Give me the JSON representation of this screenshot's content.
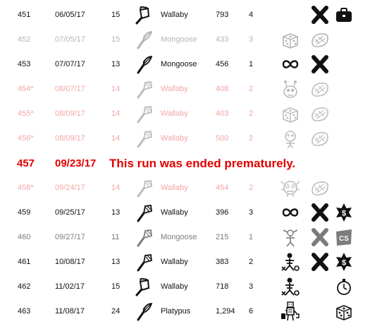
{
  "runs": [
    {
      "num": "451",
      "date": "06/05/17",
      "level": "15",
      "name": "Wallaby",
      "score": "793",
      "count": "4",
      "state": "normal",
      "icons": {
        "char": "pan-icon",
        "a": "",
        "b": "x-mark-icon",
        "c": "briefcase-icon"
      }
    },
    {
      "num": "452",
      "date": "07/05/17",
      "level": "15",
      "name": "Mongoose",
      "score": "433",
      "count": "3",
      "state": "ghost",
      "icons": {
        "char": "whisk-icon",
        "a": "dice-icon",
        "b": "steak-icon",
        "c": ""
      }
    },
    {
      "num": "453",
      "date": "07/07/17",
      "level": "13",
      "name": "Mongoose",
      "score": "456",
      "count": "1",
      "state": "normal",
      "icons": {
        "char": "whisk-icon",
        "a": "infinity-icon",
        "b": "x-mark-icon",
        "c": ""
      }
    },
    {
      "num": "454*",
      "date": "08/07/17",
      "level": "14",
      "name": "Wallaby",
      "score": "408",
      "count": "2",
      "state": "pink",
      "icons": {
        "char": "spatula-icon",
        "a": "alien-icon",
        "b": "steak-icon",
        "c": ""
      }
    },
    {
      "num": "455*",
      "date": "08/09/17",
      "level": "14",
      "name": "Wallaby",
      "score": "403",
      "count": "2",
      "state": "pink",
      "icons": {
        "char": "spatula-icon",
        "a": "dice-icon",
        "b": "steak-icon",
        "c": ""
      }
    },
    {
      "num": "456*",
      "date": "08/09/17",
      "level": "14",
      "name": "Wallaby",
      "score": "500",
      "count": "2",
      "state": "pink",
      "icons": {
        "char": "spatula-icon",
        "a": "skull-icon",
        "b": "steak-icon",
        "c": ""
      }
    },
    {
      "state": "ended",
      "num": "457",
      "date": "09/23/17",
      "message": "This run was ended prematurely."
    },
    {
      "num": "458*",
      "date": "09/24/17",
      "level": "14",
      "name": "Wallaby",
      "score": "454",
      "count": "2",
      "state": "pink",
      "icons": {
        "char": "spatula-icon",
        "a": "gremlin-icon",
        "b": "steak-icon",
        "c": ""
      }
    },
    {
      "num": "459",
      "date": "09/25/17",
      "level": "13",
      "name": "Wallaby",
      "score": "396",
      "count": "3",
      "state": "normal",
      "icons": {
        "char": "spatula-icon",
        "a": "infinity-icon",
        "b": "x-mark-icon",
        "c": "dollar-star-icon"
      }
    },
    {
      "num": "460",
      "date": "09/27/17",
      "level": "11",
      "name": "Mongoose",
      "score": "215",
      "count": "1",
      "state": "gray",
      "icons": {
        "char": "spatula-icon",
        "a": "goblin-icon",
        "b": "x-mark-icon",
        "c": "cs-badge-icon"
      }
    },
    {
      "num": "461",
      "date": "10/08/17",
      "level": "13",
      "name": "Wallaby",
      "score": "383",
      "count": "2",
      "state": "normal",
      "icons": {
        "char": "spatula-icon",
        "a": "skeleton-icon",
        "b": "x-mark-icon",
        "c": "dollar-star-icon"
      }
    },
    {
      "num": "462",
      "date": "11/02/17",
      "level": "15",
      "name": "Wallaby",
      "score": "718",
      "count": "3",
      "state": "normal",
      "icons": {
        "char": "pan-icon",
        "a": "skeleton-icon",
        "b": "",
        "c": "stopwatch-icon"
      }
    },
    {
      "num": "463",
      "date": "11/08/17",
      "level": "24",
      "name": "Platypus",
      "score": "1,294",
      "count": "6",
      "state": "normal",
      "icons": {
        "char": "whisk-icon",
        "a": "robot-icon",
        "b": "",
        "c": "dice-icon"
      }
    }
  ]
}
